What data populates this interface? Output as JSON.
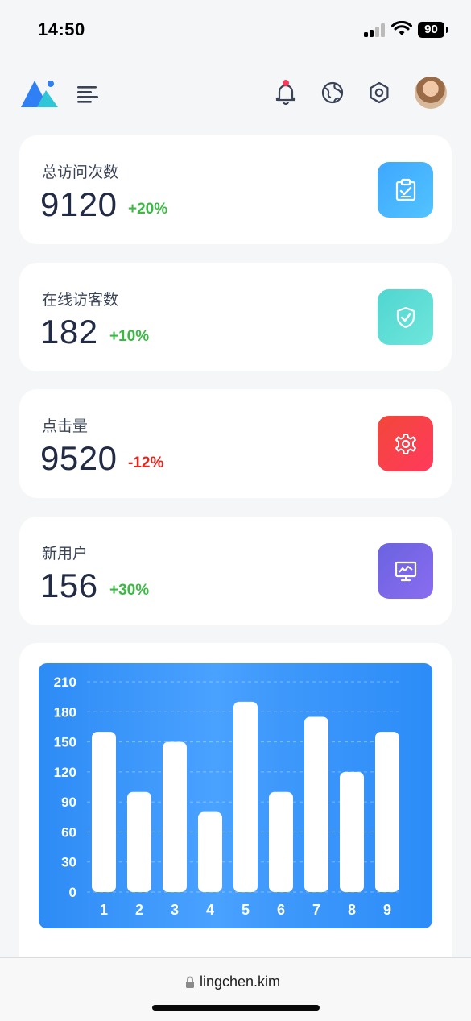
{
  "status_bar": {
    "time": "14:50",
    "battery": "90"
  },
  "stats": [
    {
      "label": "总访问次数",
      "value": "9120",
      "change": "+20%",
      "trend": "up",
      "icon": "clipboard-check-icon"
    },
    {
      "label": "在线访客数",
      "value": "182",
      "change": "+10%",
      "trend": "up",
      "icon": "shield-check-icon"
    },
    {
      "label": "点击量",
      "value": "9520",
      "change": "-12%",
      "trend": "down",
      "icon": "gear-icon"
    },
    {
      "label": "新用户",
      "value": "156",
      "change": "+30%",
      "trend": "up",
      "icon": "monitor-chart-icon"
    }
  ],
  "colors": {
    "up": "#3cb944",
    "down": "#e5261f",
    "chart_bg": "#3a95fa",
    "bar": "#ffffff"
  },
  "chart_data": {
    "type": "bar",
    "categories": [
      "1",
      "2",
      "3",
      "4",
      "5",
      "6",
      "7",
      "8",
      "9"
    ],
    "values": [
      160,
      100,
      150,
      80,
      190,
      100,
      175,
      120,
      160
    ],
    "yticks": [
      "0",
      "30",
      "60",
      "90",
      "120",
      "150",
      "180",
      "210"
    ],
    "ylim": [
      0,
      210
    ],
    "grid": true
  },
  "browser": {
    "url": "lingchen.kim"
  }
}
